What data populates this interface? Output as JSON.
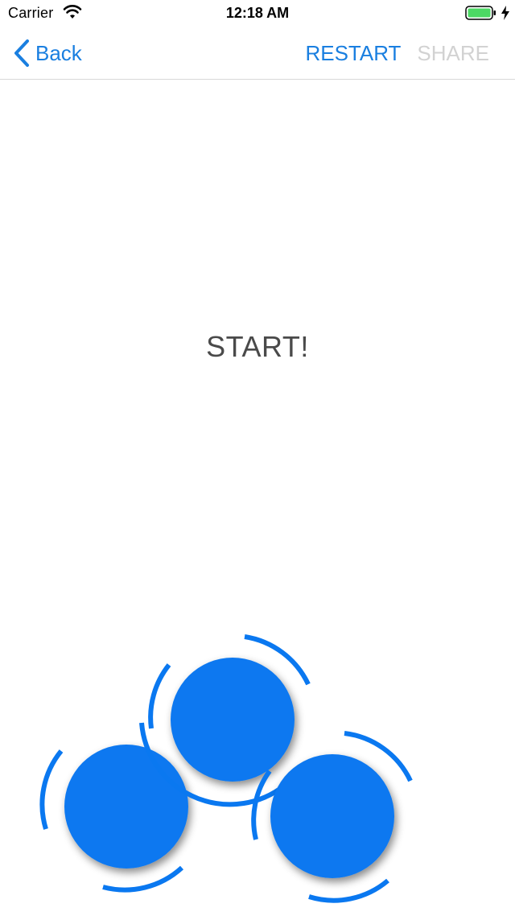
{
  "status_bar": {
    "carrier": "Carrier",
    "time": "12:18 AM",
    "battery_color": "#4cd964"
  },
  "nav": {
    "back_label": "Back",
    "restart_label": "RESTART",
    "share_label": "SHARE"
  },
  "content": {
    "start_label": "START!"
  },
  "colors": {
    "accent": "#1a7fe0",
    "circle": "#0a78f0",
    "disabled": "#d2d2d2"
  },
  "touch_points": {
    "count": 3
  }
}
